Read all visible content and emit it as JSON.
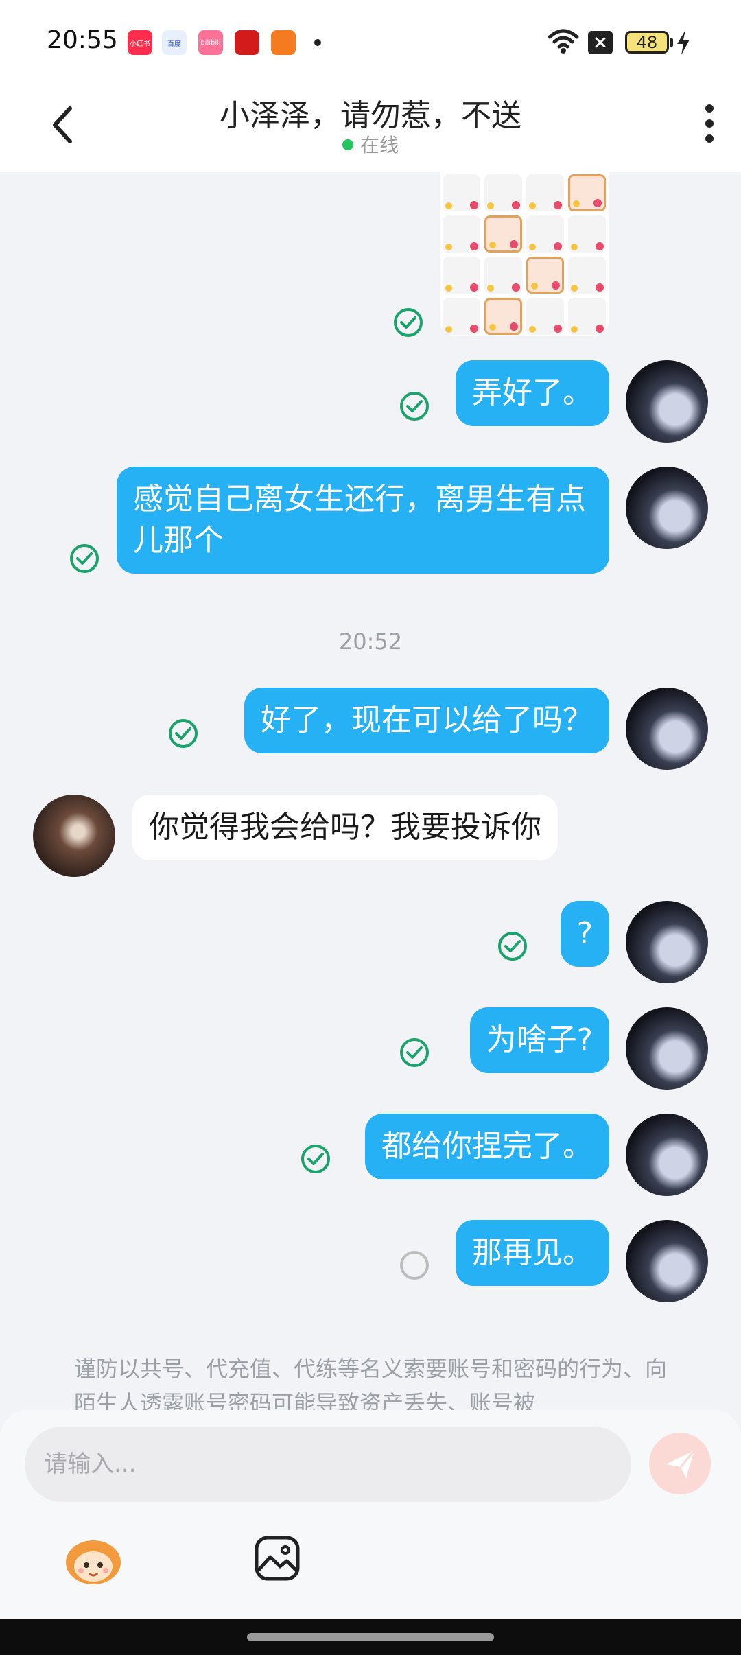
{
  "status_bar": {
    "time": "20:55",
    "battery": "48",
    "app_icons": [
      "小红书",
      "百度",
      "bilibili",
      "app",
      "app"
    ]
  },
  "header": {
    "title": "小泽泽，请勿惹，不送",
    "status": "在线"
  },
  "messages": [
    {
      "side": "right",
      "text": "弄好了。",
      "status": "read"
    },
    {
      "side": "right",
      "text": "感觉自己离女生还行，离男生有点儿那个",
      "status": "read"
    },
    {
      "side": "right",
      "text": "好了，现在可以给了吗？",
      "status": "read"
    },
    {
      "side": "left",
      "text": "你觉得我会给吗？我要投诉你"
    },
    {
      "side": "right",
      "text": "?",
      "status": "read"
    },
    {
      "side": "right",
      "text": "为啥子?",
      "status": "read"
    },
    {
      "side": "right",
      "text": "都给你捏完了。",
      "status": "read"
    },
    {
      "side": "right",
      "text": "那再见。",
      "status": "sending"
    }
  ],
  "timestamp": "20:52",
  "notice": "谨防以共号、代充值、代练等名义索要账号和密码的行为、向陌生人透露账号密码可能导致资产丢失、账号被",
  "input": {
    "placeholder": "请输入..."
  },
  "colors": {
    "my_bubble": "#25b1f4",
    "their_bubble": "#ffffff",
    "check_green": "#1aa36b",
    "background": "#f1f3f7"
  },
  "icons": {
    "back": "chevron-left-icon",
    "more": "more-vertical-icon",
    "send": "send-icon",
    "image": "image-icon",
    "emoji": "mascot-icon"
  }
}
